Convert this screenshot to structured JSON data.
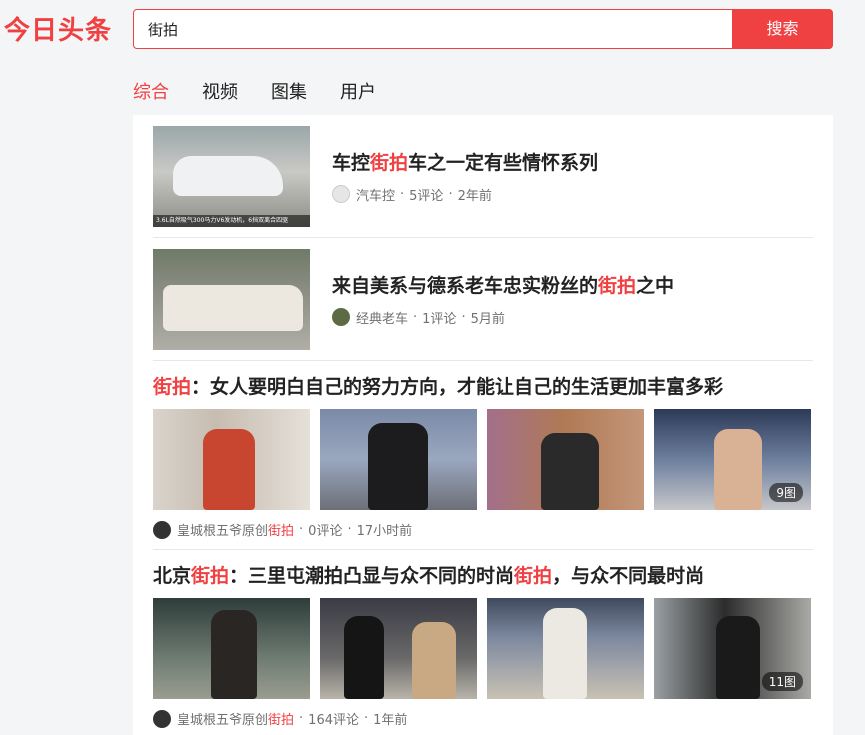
{
  "header": {
    "logo": "今日头条",
    "search_value": "街拍",
    "search_button": "搜索"
  },
  "tabs": [
    {
      "label": "综合",
      "active": true
    },
    {
      "label": "视频",
      "active": false
    },
    {
      "label": "图集",
      "active": false
    },
    {
      "label": "用户",
      "active": false
    }
  ],
  "results": [
    {
      "title_pre": "车控",
      "title_hl": "街拍",
      "title_post": "车之一定有些情怀系列",
      "thumb_caption": "3.6L自然吸气300马力V6发动机，6挡双离合四驱",
      "source": "汽车控",
      "comments": "5评论",
      "time": "2年前"
    },
    {
      "title_pre": "来自美系与德系老车忠实粉丝的",
      "title_hl": "街拍",
      "title_post": "之中",
      "source": "经典老车",
      "comments": "1评论",
      "time": "5月前"
    },
    {
      "title_hl1": "街拍",
      "title_mid": "：女人要明白自己的努力方向，才能让自己的生活更加丰富多彩",
      "image_count": "9图",
      "source": "皇城根五爷原创",
      "source_hl": "街拍",
      "comments": "0评论",
      "time": "17小时前"
    },
    {
      "title_pre": "北京",
      "title_hl1": "街拍",
      "title_mid": "：三里屯潮拍凸显与众不同的时尚",
      "title_hl2": "街拍",
      "title_post": "，与众不同最时尚",
      "image_count": "11图",
      "source": "皇城根五爷原创",
      "source_hl": "街拍",
      "comments": "164评论",
      "time": "1年前"
    }
  ],
  "separator": "·",
  "colors": {
    "accent": "#f04142",
    "page_bg": "#f4f5f6"
  }
}
